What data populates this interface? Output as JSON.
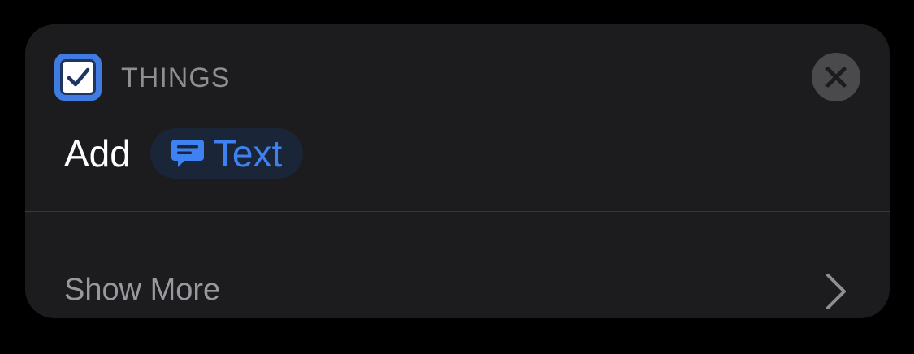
{
  "header": {
    "app_name": "THINGS",
    "app_icon": "checkbox-icon",
    "close_icon": "close-icon"
  },
  "action": {
    "verb": "Add",
    "parameter": {
      "label": "Text",
      "icon": "message-bubble-icon"
    }
  },
  "footer": {
    "show_more_label": "Show More",
    "chevron_icon": "chevron-right-icon"
  },
  "colors": {
    "card_background": "#1c1c1e",
    "accent_blue": "#3d82f0",
    "app_icon_blue": "#3f7be0",
    "secondary_text": "#8e8e93"
  }
}
